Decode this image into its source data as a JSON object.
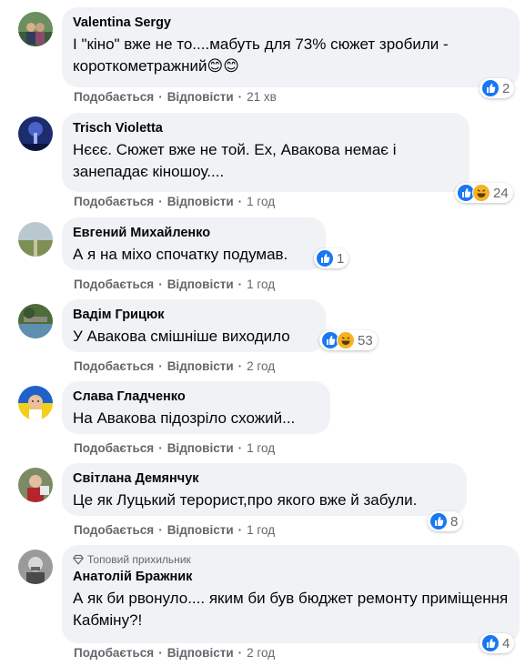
{
  "ui": {
    "like_label": "Подобається",
    "reply_label": "Відповісти",
    "separator": "·"
  },
  "comments": [
    {
      "name": "Valentina Sergy",
      "text": "І \"кіно\" вже не то....мабуть для 73% сюжет зробили - короткометражний😊😊",
      "time": "21 хв",
      "reactions": [
        "like"
      ],
      "count": "2"
    },
    {
      "name": "Trisch Violetta",
      "text": "Нєєє. Сюжет вже не той. Ех, Авакова немає і занепадає кіношоу....",
      "time": "1 год",
      "reactions": [
        "like",
        "haha"
      ],
      "count": "24"
    },
    {
      "name": "Евгений Михайленко",
      "text": "А я на міхо спочатку подумав.",
      "time": "1 год",
      "reactions": [
        "like"
      ],
      "count": "1"
    },
    {
      "name": "Вадім Грицюк",
      "text": "У Авакова смішніше виходило",
      "time": "2 год",
      "reactions": [
        "like",
        "haha"
      ],
      "count": "53"
    },
    {
      "name": "Слава Гладченко",
      "text": "На Авакова підозріло схожий...",
      "time": "1 год",
      "reactions": [],
      "count": ""
    },
    {
      "name": "Світлана Демянчук",
      "text": "Це як Луцький терорист,про якого вже й забули.",
      "time": "1 год",
      "reactions": [
        "like"
      ],
      "count": "8"
    },
    {
      "name": "Анатолій Бражник",
      "badge": "Топовий прихильник",
      "badge_icon": "diamond-icon",
      "text": "А як би рвонуло.... яким би був бюджет ремонту приміщення Кабміну?!",
      "time": "2 год",
      "reactions": [
        "like"
      ],
      "count": "4"
    }
  ],
  "colors": {
    "bubble": "#f0f2f5",
    "like": "#1877f2",
    "haha": "#f7b125",
    "meta": "#65676b"
  }
}
